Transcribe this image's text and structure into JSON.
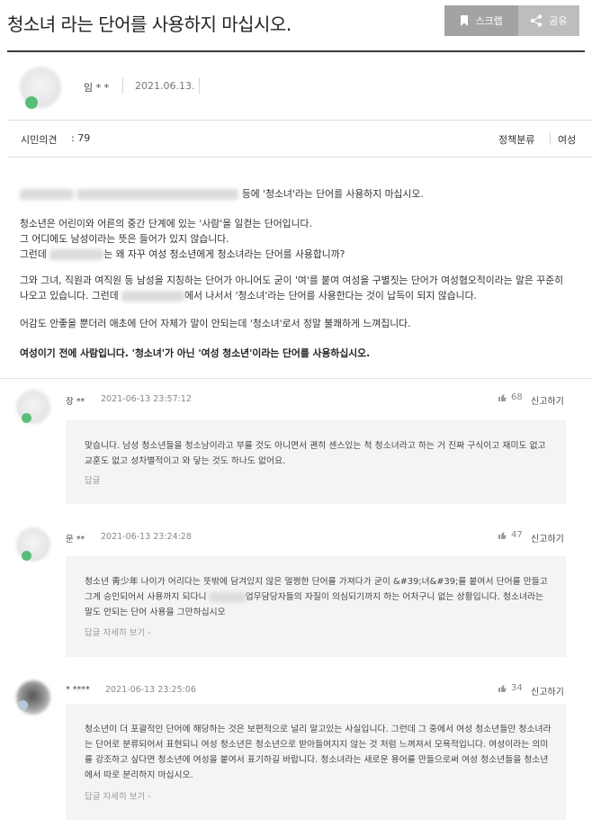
{
  "title": "청소녀 라는 단어를 사용하지 마십시오.",
  "actions": {
    "scrap_label": "스크랩",
    "share_label": "공유"
  },
  "author": {
    "name": "임 * *",
    "date": "2021.06.13."
  },
  "meta": {
    "opinion_label": "시민의견",
    "opinion_count": ": 79",
    "category_label": "정책분류",
    "category_value": "여성"
  },
  "body": {
    "p1_tail": "등에 '청소녀'라는 단어를 사용하지 마십시오.",
    "p2_line1": "청소년은 어린이와 어른의 중간 단계에 있는 '사람'을 일컫는 단어입니다.",
    "p2_line2": "그 어디에도 남성이라는 뜻은 들어가 있지 않습니다.",
    "p2_line3_head": "그런데",
    "p2_line3_tail": "는 왜 자꾸 여성 청소년에게 청소녀라는 단어를 사용합니까?",
    "p3_head": "그와 그녀, 직원과 여직원 등 남성을 지칭하는 단어가 아니어도 굳이 '여'를 붙여 여성을 구별짓는 단어가 여성혐오적이라는 말은 꾸준히 나오고 있습니다. 그런데",
    "p3_tail": "에서 나서서 '청소녀'라는 단어를 사용한다는 것이 납득이 되지 않습니다.",
    "p4": "어감도 안좋을 뿐더러 애초에 단어 자체가 말이 안되는데 '청소녀'로서 정말 불쾌하게 느껴집니다.",
    "p5": "여성이기 전에 사람입니다. '청소녀'가 아닌 '여성 청소년'이라는 단어를 사용하십시오."
  },
  "comments": [
    {
      "name": "장 **",
      "date": "2021-06-13 23:57:12",
      "likes": "68",
      "report_label": "신고하기",
      "text": "맞습니다. 남성 청소년들을 청소남이라고 부를 것도 아니면서 괜히 센스있는 척 청소녀라고 하는 거 진짜 구식이고 재미도 없고 교훈도 없고 성차별적이고 와 닿는 것도 하나도 없어요.",
      "reply_label": "답글"
    },
    {
      "name": "문 **",
      "date": "2021-06-13 23:24:28",
      "likes": "47",
      "report_label": "신고하기",
      "text_head": "청소년 靑少年 나이가 어리다는 뜻밖에 담겨있지 않은 멀쩡한 단어를 가져다가 굳이 &#39;녀&#39;를 붙여서 단어를 만들고 그게 승인되어서 사용까지 되다니",
      "text_tail": "업무담당자들의 자질이 의심되기까지 하는 어처구니 없는 상황입니다. 청소녀라는 말도 안되는 단어 사용을 그만하십시오",
      "reply_label": "답글 자세히 보기 -"
    },
    {
      "name": "* ****",
      "date": "2021-06-13 23:25:06",
      "likes": "34",
      "report_label": "신고하기",
      "text": "청소년이 더 포괄적인 단어에 해당하는 것은 보편적으로 널리 알고있는 사실입니다. 그런데 그 중에서 여성 청소년들만 청소녀라는 단어로 분류되어서 표현되니 여성 청소년은 청소년으로 받아들여지지 않는 것 처럼 느껴져서 모욕적입니다. 여성이라는 의미를 강조하고 싶다면 청소년에 여성을 붙여서 표기하길 바랍니다. 청소녀라는 새로운 용어를 만들으로써 여성 청소년들을 청소년에서 따로 분리하지 마십시오.",
      "reply_label": "답글 자세히 보기 -"
    }
  ]
}
